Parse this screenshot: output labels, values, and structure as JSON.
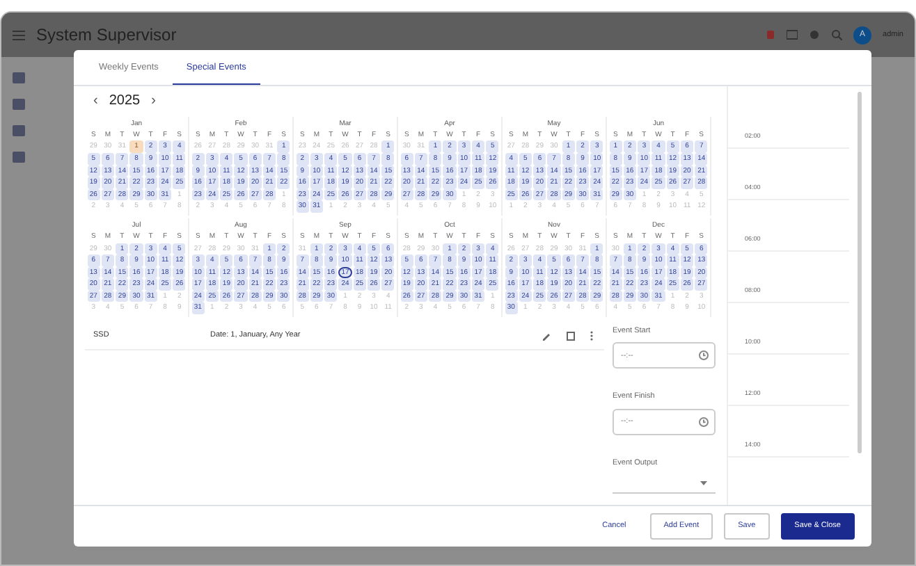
{
  "app": {
    "title": "System Supervisor",
    "user": "admin",
    "avatar": "A"
  },
  "tabs": [
    {
      "label": "Weekly Events",
      "selected": false
    },
    {
      "label": "Special Events",
      "selected": true
    }
  ],
  "year_nav": {
    "prev": "‹",
    "year": "2025",
    "next": "›"
  },
  "months": [
    {
      "name": "Jan",
      "weekdays": [
        "S",
        "M",
        "T",
        "W",
        "T",
        "F",
        "S"
      ],
      "leading": [
        "29",
        "30",
        "31"
      ],
      "days": [
        {
          "text": "1",
          "kind": "event"
        },
        "2",
        "3",
        "4",
        "5",
        "6",
        "7",
        "8",
        "9",
        "10",
        "11",
        "12",
        "13",
        "14",
        "15",
        "16",
        "17",
        "18",
        "19",
        "20",
        "21",
        "22",
        "23",
        "24",
        "25",
        "26",
        "27",
        "28",
        "29",
        "30",
        "31"
      ],
      "trailing": [
        "1",
        "2",
        "3",
        "4",
        "5",
        "6",
        "7",
        "8"
      ]
    },
    {
      "name": "Feb",
      "weekdays": [
        "S",
        "M",
        "T",
        "W",
        "T",
        "F",
        "S"
      ],
      "leading": [
        "26",
        "27",
        "28",
        "29",
        "30",
        "31"
      ],
      "days": [
        "1",
        "2",
        "3",
        "4",
        "5",
        "6",
        "7",
        "8",
        "9",
        "10",
        "11",
        "12",
        "13",
        "14",
        "15",
        "16",
        "17",
        "18",
        "19",
        "20",
        "21",
        "22",
        "23",
        "24",
        "25",
        "26",
        "27",
        "28"
      ],
      "trailing": [
        "1",
        "2",
        "3",
        "4",
        "5",
        "6",
        "7",
        "8"
      ]
    },
    {
      "name": "Mar",
      "weekdays": [
        "S",
        "M",
        "T",
        "W",
        "T",
        "F",
        "S"
      ],
      "leading": [
        "23",
        "24",
        "25",
        "26",
        "27",
        "28"
      ],
      "days": [
        "1",
        "2",
        "3",
        "4",
        "5",
        "6",
        "7",
        "8",
        "9",
        "10",
        "11",
        "12",
        "13",
        "14",
        "15",
        "16",
        "17",
        "18",
        "19",
        "20",
        "21",
        "22",
        "23",
        "24",
        "25",
        "26",
        "27",
        "28",
        "29",
        "30",
        "31"
      ],
      "trailing": [
        "1",
        "2",
        "3",
        "4",
        "5"
      ]
    },
    {
      "name": "Apr",
      "weekdays": [
        "S",
        "M",
        "T",
        "W",
        "T",
        "F",
        "S"
      ],
      "leading": [
        "30",
        "31"
      ],
      "days": [
        "1",
        "2",
        "3",
        "4",
        "5",
        "6",
        "7",
        "8",
        "9",
        "10",
        "11",
        "12",
        "13",
        "14",
        "15",
        "16",
        "17",
        "18",
        "19",
        "20",
        "21",
        "22",
        "23",
        "24",
        "25",
        "26",
        "27",
        "28",
        "29",
        "30"
      ],
      "trailing": [
        "1",
        "2",
        "3",
        "4",
        "5",
        "6",
        "7",
        "8",
        "9",
        "10"
      ]
    },
    {
      "name": "May",
      "weekdays": [
        "S",
        "M",
        "T",
        "W",
        "T",
        "F",
        "S"
      ],
      "leading": [
        "27",
        "28",
        "29",
        "30"
      ],
      "days": [
        "1",
        "2",
        "3",
        "4",
        "5",
        "6",
        "7",
        "8",
        "9",
        "10",
        "11",
        "12",
        "13",
        "14",
        "15",
        "16",
        "17",
        "18",
        "19",
        "20",
        "21",
        "22",
        "23",
        "24",
        "25",
        "26",
        "27",
        "28",
        "29",
        "30",
        "31"
      ],
      "trailing": [
        "1",
        "2",
        "3",
        "4",
        "5",
        "6",
        "7"
      ]
    },
    {
      "name": "Jun",
      "weekdays": [
        "S",
        "M",
        "T",
        "W",
        "T",
        "F",
        "S"
      ],
      "days": [
        "1",
        "2",
        "3",
        "4",
        "5",
        "6",
        "7",
        "8",
        "9",
        "10",
        "11",
        "12",
        "13",
        "14",
        "15",
        "16",
        "17",
        "18",
        "19",
        "20",
        "21",
        "22",
        "23",
        "24",
        "25",
        "26",
        "27",
        "28",
        "29",
        "30"
      ],
      "trailing": [
        "1",
        "2",
        "3",
        "4",
        "5",
        "6",
        "7",
        "8",
        "9",
        "10",
        "11",
        "12"
      ]
    },
    {
      "name": "Jul",
      "weekdays": [
        "S",
        "M",
        "T",
        "W",
        "T",
        "F",
        "S"
      ],
      "leading": [
        "29",
        "30"
      ],
      "days": [
        "1",
        "2",
        "3",
        "4",
        "5",
        "6",
        "7",
        "8",
        "9",
        "10",
        "11",
        "12",
        "13",
        "14",
        "15",
        "16",
        "17",
        "18",
        "19",
        "20",
        "21",
        "22",
        "23",
        "24",
        "25",
        "26",
        "27",
        "28",
        "29",
        "30",
        "31"
      ],
      "trailing": [
        "1",
        "2",
        "3",
        "4",
        "5",
        "6",
        "7",
        "8",
        "9"
      ]
    },
    {
      "name": "Aug",
      "weekdays": [
        "S",
        "M",
        "T",
        "W",
        "T",
        "F",
        "S"
      ],
      "leading": [
        "27",
        "28",
        "29",
        "30",
        "31"
      ],
      "days": [
        "1",
        "2",
        "3",
        "4",
        "5",
        "6",
        "7",
        "8",
        "9",
        "10",
        "11",
        "12",
        "13",
        "14",
        "15",
        "16",
        "17",
        "18",
        "19",
        "20",
        "21",
        "22",
        "23",
        "24",
        "25",
        "26",
        "27",
        "28",
        "29",
        "30",
        "31"
      ],
      "trailing": [
        "1",
        "2",
        "3",
        "4",
        "5",
        "6"
      ]
    },
    {
      "name": "Sep",
      "weekdays": [
        "S",
        "M",
        "T",
        "W",
        "T",
        "F",
        "S"
      ],
      "leading": [
        "31"
      ],
      "days": [
        "1",
        "2",
        "3",
        "4",
        "5",
        "6",
        "7",
        "8",
        "9",
        "10",
        "11",
        "12",
        "13",
        "14",
        "15",
        "16",
        {
          "text": "17",
          "kind": "today"
        },
        "18",
        "19",
        "20",
        "21",
        "22",
        "23",
        "24",
        "25",
        "26",
        "27",
        "28",
        "29",
        "30"
      ],
      "trailing": [
        "1",
        "2",
        "3",
        "4",
        "5",
        "6",
        "7",
        "8",
        "9",
        "10",
        "11"
      ]
    },
    {
      "name": "Oct",
      "weekdays": [
        "S",
        "M",
        "T",
        "W",
        "T",
        "F",
        "S"
      ],
      "leading": [
        "28",
        "29",
        "30"
      ],
      "days": [
        "1",
        "2",
        "3",
        "4",
        "5",
        "6",
        "7",
        "8",
        "9",
        "10",
        "11",
        "12",
        "13",
        "14",
        "15",
        "16",
        "17",
        "18",
        "19",
        "20",
        "21",
        "22",
        "23",
        "24",
        "25",
        "26",
        "27",
        "28",
        "29",
        "30",
        "31"
      ],
      "trailing": [
        "1",
        "2",
        "3",
        "4",
        "5",
        "6",
        "7",
        "8"
      ]
    },
    {
      "name": "Nov",
      "weekdays": [
        "S",
        "M",
        "T",
        "W",
        "T",
        "F",
        "S"
      ],
      "leading": [
        "26",
        "27",
        "28",
        "29",
        "30",
        "31"
      ],
      "days": [
        "1",
        "2",
        "3",
        "4",
        "5",
        "6",
        "7",
        "8",
        "9",
        "10",
        "11",
        "12",
        "13",
        "14",
        "15",
        "16",
        "17",
        "18",
        "19",
        "20",
        "21",
        "22",
        "23",
        "24",
        "25",
        "26",
        "27",
        "28",
        "29",
        "30"
      ],
      "trailing": [
        "1",
        "2",
        "3",
        "4",
        "5",
        "6"
      ]
    },
    {
      "name": "Dec",
      "weekdays": [
        "S",
        "M",
        "T",
        "W",
        "T",
        "F",
        "S"
      ],
      "leading": [
        "30"
      ],
      "days": [
        "1",
        "2",
        "3",
        "4",
        "5",
        "6",
        "7",
        "8",
        "9",
        "10",
        "11",
        "12",
        "13",
        "14",
        "15",
        "16",
        "17",
        "18",
        "19",
        "20",
        "21",
        "22",
        "23",
        "24",
        "25",
        "26",
        "27",
        "28",
        "29",
        "30",
        "31"
      ],
      "trailing": [
        "1",
        "2",
        "3",
        "4",
        "5",
        "6",
        "7",
        "8",
        "9",
        "10"
      ]
    }
  ],
  "events": [
    {
      "name": "SSD",
      "description": "Date: 1, January, Any Year"
    }
  ],
  "form": {
    "start": {
      "label": "Event Start",
      "placeholder": "--:--"
    },
    "finish": {
      "label": "Event Finish",
      "placeholder": "--:--"
    },
    "output": {
      "label": "Event Output"
    }
  },
  "timeline": [
    "02:00",
    "04:00",
    "06:00",
    "08:00",
    "10:00",
    "12:00",
    "14:00"
  ],
  "buttons": [
    {
      "label": "Cancel",
      "kind": "text"
    },
    {
      "label": "Add Event",
      "kind": "outline"
    },
    {
      "label": "Save",
      "kind": "outline"
    },
    {
      "label": "Save & Close",
      "kind": "primary"
    }
  ]
}
